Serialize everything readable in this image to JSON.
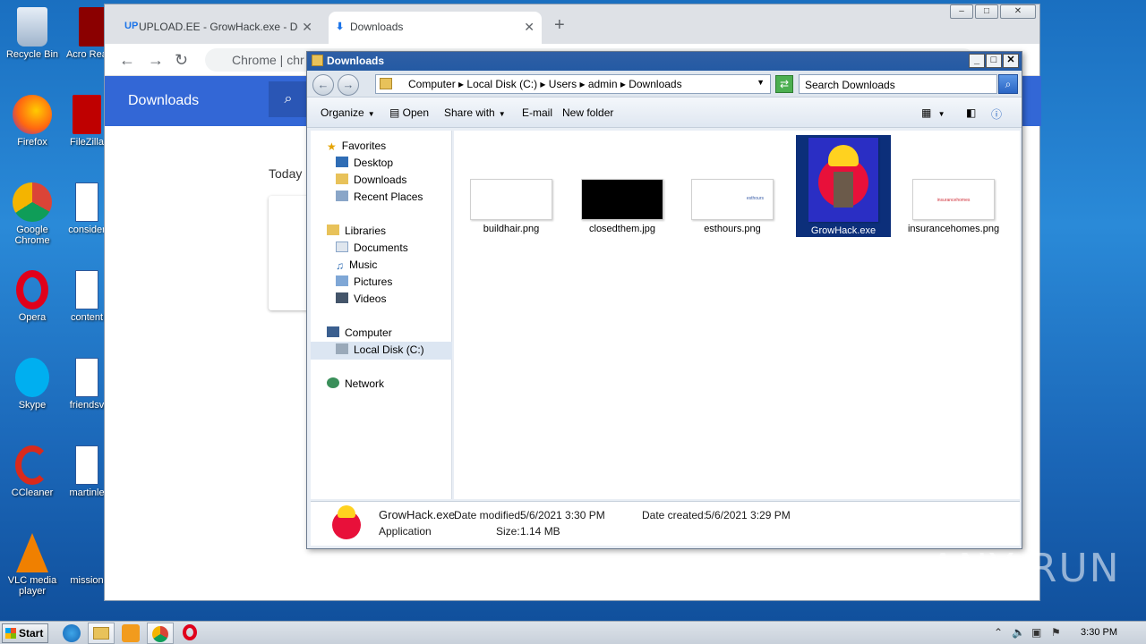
{
  "desktop": {
    "icons": [
      {
        "label": "Recycle Bin"
      },
      {
        "label": "Acro Reade"
      },
      {
        "label": "Firefox"
      },
      {
        "label": "FileZilla"
      },
      {
        "label": "Google Chrome"
      },
      {
        "label": "consider"
      },
      {
        "label": "Opera"
      },
      {
        "label": "content"
      },
      {
        "label": "Skype"
      },
      {
        "label": "friendsv"
      },
      {
        "label": "CCleaner"
      },
      {
        "label": "martinle"
      },
      {
        "label": "VLC media player"
      },
      {
        "label": "mission"
      }
    ]
  },
  "chrome": {
    "tabs": [
      {
        "icon": "UP",
        "label": "UPLOAD.EE - GrowHack.exe - Downl"
      },
      {
        "icon": "download-icon",
        "label": "Downloads"
      }
    ],
    "omnibox": "Chrome  |  chr",
    "page_title": "Downloads",
    "today_label": "Today"
  },
  "explorer": {
    "title": "Downloads",
    "breadcrumb": [
      "Computer",
      "Local Disk (C:)",
      "Users",
      "admin",
      "Downloads"
    ],
    "search_placeholder": "Search Downloads",
    "commands": {
      "organize": "Organize",
      "open": "Open",
      "share_with": "Share with",
      "email": "E-mail",
      "new_folder": "New folder"
    },
    "nav": {
      "favorites": "Favorites",
      "desktop": "Desktop",
      "downloads": "Downloads",
      "recent_places": "Recent Places",
      "libraries": "Libraries",
      "documents": "Documents",
      "music": "Music",
      "pictures": "Pictures",
      "videos": "Videos",
      "computer": "Computer",
      "local_disk": "Local Disk (C:)",
      "network": "Network"
    },
    "files": [
      {
        "name": "buildhair.png",
        "thumb_text": "",
        "thumb_bg": "#ffffff"
      },
      {
        "name": "closedthem.jpg",
        "thumb_text": "",
        "thumb_bg": "#000000"
      },
      {
        "name": "esthours.png",
        "thumb_text": "esthours",
        "thumb_bg": "#ffffff"
      },
      {
        "name": "GrowHack.exe",
        "thumb_text": "",
        "thumb_bg": "#2a2ec4",
        "selected": true
      },
      {
        "name": "insurancehomes.png",
        "thumb_text": "insurancehomes",
        "thumb_bg": "#ffffff"
      }
    ],
    "details": {
      "name": "GrowHack.exe",
      "type": "Application",
      "modified_label": "Date modified:",
      "modified": "5/6/2021 3:30 PM",
      "created_label": "Date created:",
      "created": "5/6/2021 3:29 PM",
      "size_label": "Size:",
      "size": "1.14 MB"
    }
  },
  "taskbar": {
    "start": "Start",
    "clock": "3:30 PM"
  },
  "watermark": "ANY RUN"
}
